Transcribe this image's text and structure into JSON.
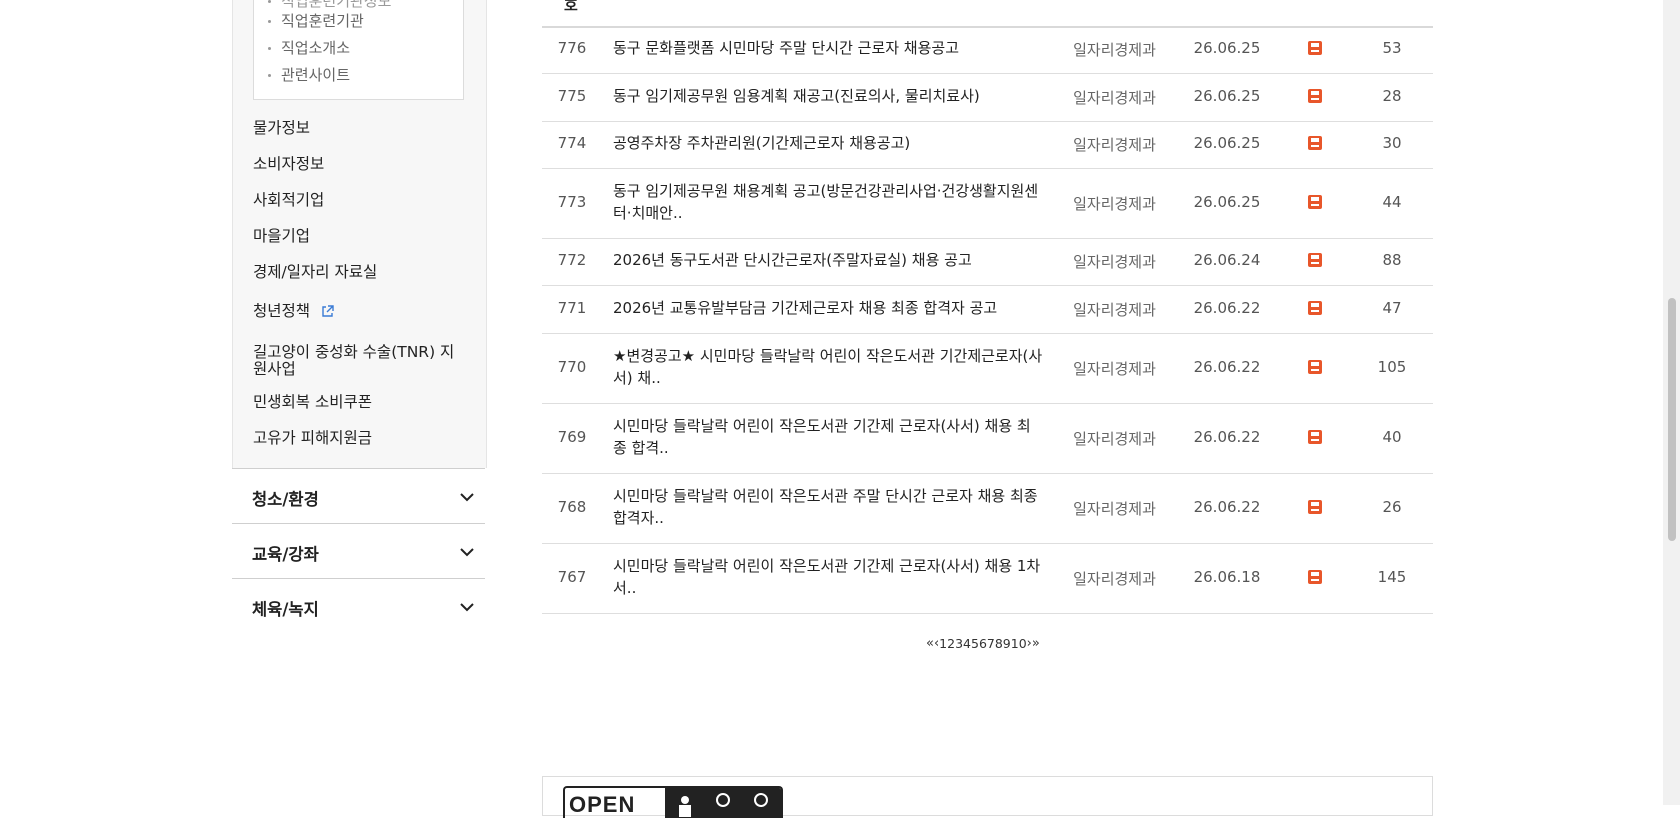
{
  "sidebar": {
    "sub_items": [
      {
        "label": "직업훈련기관"
      },
      {
        "label": "직업소개소"
      },
      {
        "label": "관련사이트"
      }
    ],
    "links": [
      {
        "label": "물가정보"
      },
      {
        "label": "소비자정보"
      },
      {
        "label": "사회적기업"
      },
      {
        "label": "마을기업"
      },
      {
        "label": "경제/일자리 자료실"
      },
      {
        "label": "청년정책"
      },
      {
        "label": "길고양이 중성화 수술(TNR) 지원사업"
      },
      {
        "label": "민생회복 소비쿠폰"
      },
      {
        "label": "고유가 피해지원금"
      }
    ],
    "accordions": [
      {
        "label": "청소/환경"
      },
      {
        "label": "교육/강좌"
      },
      {
        "label": "체육/녹지"
      }
    ]
  },
  "table": {
    "header_fragment": "호",
    "rows": [
      {
        "num": "776",
        "title": "동구 문화플랫폼 시민마당 주말 단시간 근로자 채용공고",
        "dept": "일자리경제과",
        "date": "26.06.25",
        "views": "53"
      },
      {
        "num": "775",
        "title": "동구 임기제공무원 임용계획 재공고(진료의사, 물리치료사)",
        "dept": "일자리경제과",
        "date": "26.06.25",
        "views": "28"
      },
      {
        "num": "774",
        "title": "공영주차장 주차관리원(기간제근로자 채용공고)",
        "dept": "일자리경제과",
        "date": "26.06.25",
        "views": "30"
      },
      {
        "num": "773",
        "title": "동구 임기제공무원 채용계획 공고(방문건강관리사업·건강생활지원센터·치매안..",
        "dept": "일자리경제과",
        "date": "26.06.25",
        "views": "44"
      },
      {
        "num": "772",
        "title": "2026년 동구도서관 단시간근로자(주말자료실) 채용 공고",
        "dept": "일자리경제과",
        "date": "26.06.24",
        "views": "88"
      },
      {
        "num": "771",
        "title": "2026년 교통유발부담금 기간제근로자 채용 최종 합격자 공고",
        "dept": "일자리경제과",
        "date": "26.06.22",
        "views": "47"
      },
      {
        "num": "770",
        "title": "★변경공고★ 시민마당 들락날락 어린이 작은도서관 기간제근로자(사서) 채..",
        "dept": "일자리경제과",
        "date": "26.06.22",
        "views": "105"
      },
      {
        "num": "769",
        "title": "시민마당 들락날락 어린이 작은도서관 기간제 근로자(사서) 채용 최종 합격..",
        "dept": "일자리경제과",
        "date": "26.06.22",
        "views": "40"
      },
      {
        "num": "768",
        "title": "시민마당 들락날락 어린이 작은도서관 주말 단시간 근로자 채용 최종합격자..",
        "dept": "일자리경제과",
        "date": "26.06.22",
        "views": "26"
      },
      {
        "num": "767",
        "title": "시민마당 들락날락 어린이 작은도서관 기간제 근로자(사서) 채용 1차 서..",
        "dept": "일자리경제과",
        "date": "26.06.18",
        "views": "145"
      }
    ]
  },
  "pagination": {
    "first": "«",
    "prev": "‹",
    "pages": [
      "1",
      "2",
      "3",
      "4",
      "5",
      "6",
      "7",
      "8",
      "9",
      "10"
    ],
    "next": "›",
    "last": "»"
  },
  "footer": {
    "logo_text": "OPEN"
  },
  "icons": {
    "file": "save-file-icon",
    "external": "external-link-icon",
    "chevron": "chevron-down-icon"
  },
  "colors": {
    "file_icon": "#e8562a",
    "external_icon": "#3a7bd5"
  }
}
